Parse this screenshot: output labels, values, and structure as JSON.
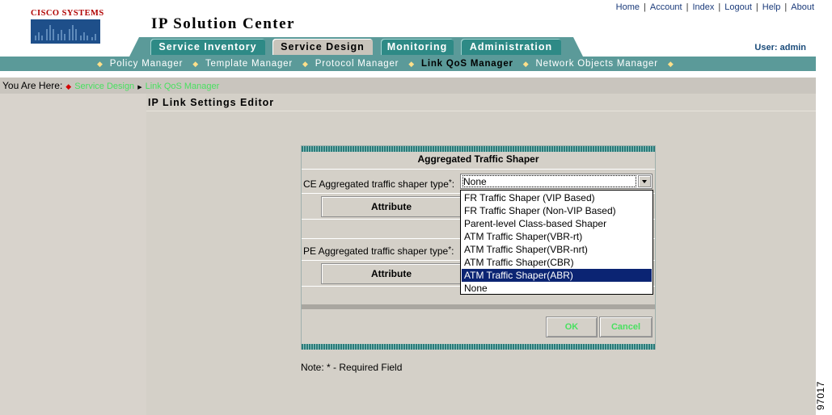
{
  "header": {
    "brand": "Cisco Systems",
    "app_title": "IP Solution Center",
    "user_label": "User: admin",
    "top_links": [
      "Home",
      "Account",
      "Index",
      "Logout",
      "Help",
      "About"
    ]
  },
  "tabs": [
    {
      "label": "Service Inventory",
      "active": false
    },
    {
      "label": "Service Design",
      "active": true
    },
    {
      "label": "Monitoring",
      "active": false
    },
    {
      "label": "Administration",
      "active": false
    }
  ],
  "subnav": [
    {
      "label": "Policy Manager",
      "active": false
    },
    {
      "label": "Template Manager",
      "active": false
    },
    {
      "label": "Protocol Manager",
      "active": false
    },
    {
      "label": "Link QoS Manager",
      "active": true
    },
    {
      "label": "Network Objects Manager",
      "active": false
    }
  ],
  "breadcrumb": {
    "prefix": "You Are Here:",
    "items": [
      "Service Design",
      "Link QoS Manager"
    ]
  },
  "page_title": "IP Link Settings Editor",
  "form": {
    "section_title": "Aggregated Traffic Shaper",
    "ce_label": "CE Aggregated traffic shaper type",
    "pe_label": "PE Aggregated traffic shaper type",
    "required_mark": "*",
    "colon": ":",
    "attribute_header": "Attribute",
    "select_value": "None",
    "options": [
      "FR Traffic Shaper (VIP Based)",
      "FR Traffic Shaper (Non-VIP Based)",
      "Parent-level Class-based Shaper",
      "ATM Traffic Shaper(VBR-rt)",
      "ATM Traffic Shaper(VBR-nrt)",
      "ATM Traffic Shaper(CBR)",
      "ATM Traffic Shaper(ABR)",
      "None"
    ],
    "highlighted_option": "ATM Traffic Shaper(ABR)",
    "ok_label": "OK",
    "cancel_label": "Cancel"
  },
  "note": "Note: * - Required Field",
  "figure_id": "97017",
  "colors": {
    "tab_band": "#5b9a99",
    "tab": "#2e8a86",
    "active_tab": "#c9c4bb",
    "selection": "#0b2473",
    "disabled_button_text": "#49e060",
    "panel_bg": "#d4d0c8"
  }
}
